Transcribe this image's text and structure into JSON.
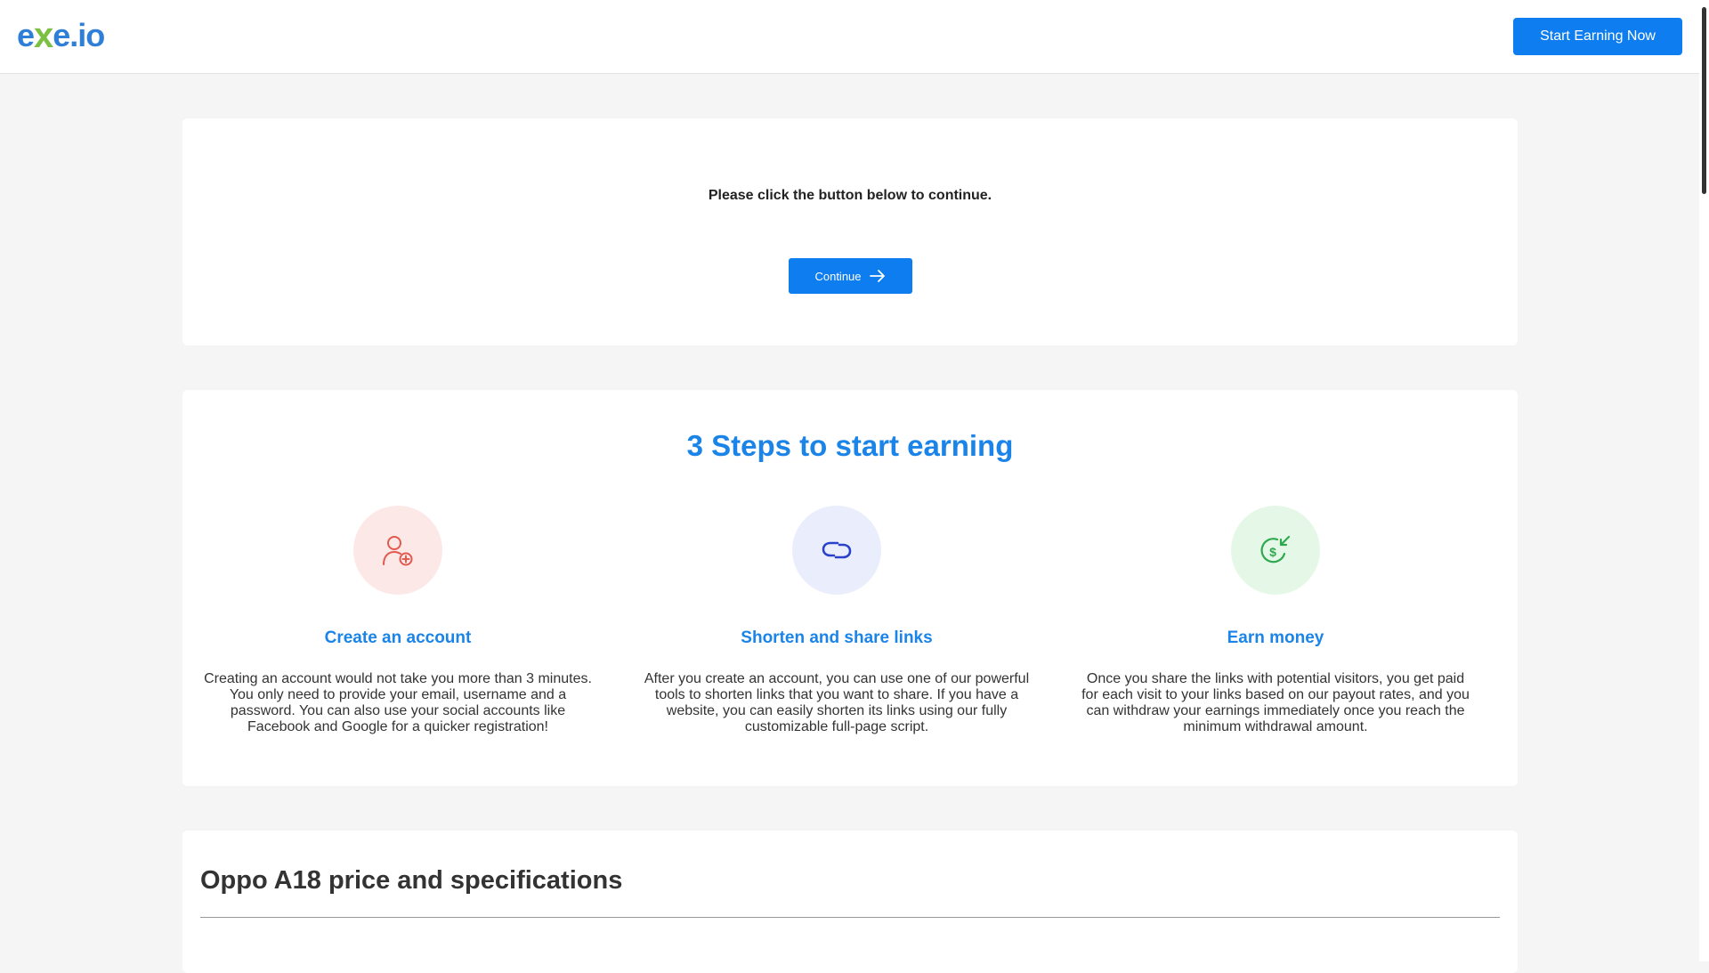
{
  "header": {
    "logo": {
      "part1": "e",
      "part2": "x",
      "part3": "e.io"
    },
    "start_button": "Start Earning Now"
  },
  "gate": {
    "prompt": "Please click the button below to continue.",
    "continue_label": "Continue"
  },
  "steps": {
    "title": "3 Steps to start earning",
    "items": [
      {
        "icon": "add-user-icon",
        "title": "Create an account",
        "text": "Creating an account would not take you more than 3 minutes. You only need to provide your email, username and a password. You can also use your social accounts like Facebook and Google for a quicker registration!"
      },
      {
        "icon": "link-icon",
        "title": "Shorten and share links",
        "text": "After you create an account, you can use one of our powerful tools to shorten links that you want to share. If you have a website, you can easily shorten its links using our fully customizable full-page script."
      },
      {
        "icon": "money-icon",
        "title": "Earn money",
        "text": "Once you share the links with potential visitors, you get paid for each visit to your links based on our payout rates, and you can withdraw your earnings immediately once you reach the minimum withdrawal amount."
      }
    ]
  },
  "article": {
    "title": "Oppo A18 price and specifications"
  },
  "colors": {
    "accent": "#0d7df0",
    "heading_blue": "#1b84e8",
    "step1_bg": "#fde8e8",
    "step2_bg": "#eaeefc",
    "step3_bg": "#e5f8e8"
  }
}
